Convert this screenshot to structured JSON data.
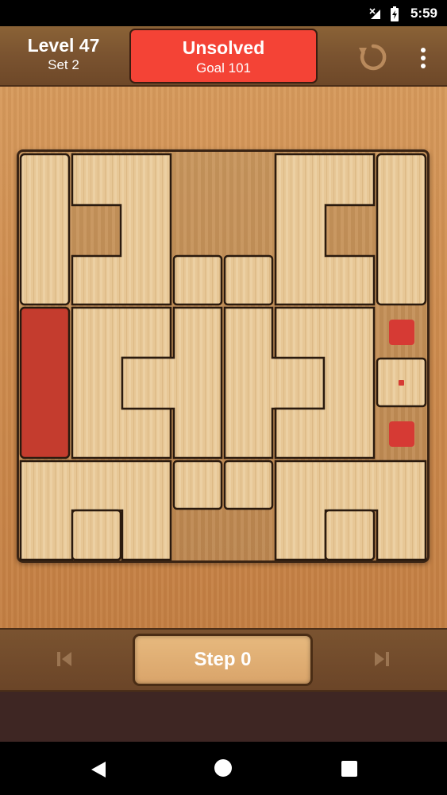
{
  "status_bar": {
    "time": "5:59"
  },
  "header": {
    "level_title": "Level 47",
    "set_label": "Set 2",
    "status_title": "Unsolved",
    "goal_label": "Goal 101",
    "status_color": "#f44336"
  },
  "controls": {
    "step_label": "Step 0",
    "prev_icon": "skip-previous-icon",
    "next_icon": "skip-next-icon"
  },
  "board": {
    "grid": "8x8",
    "target_piece_color": "#c43c2e",
    "exit_marker_color": "#d63a34",
    "wood_color": "#e7c796"
  }
}
